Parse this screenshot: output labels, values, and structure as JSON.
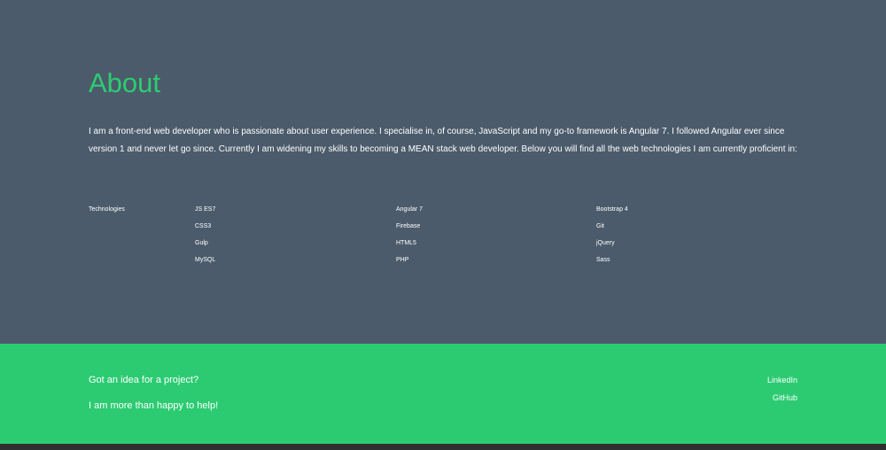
{
  "about": {
    "title": "About",
    "text": "I am a front-end web developer who is passionate about user experience. I specialise in, of course, JavaScript and my go-to framework is Angular 7. I followed Angular ever since version 1 and never let go since. Currently I am widening my skills to becoming a MEAN stack web developer. Below you will find all the web technologies I am currently proficient in:",
    "technologies_label": "Technologies",
    "technologies": [
      [
        "JS ES7",
        "Angular 7",
        "Bootstrap 4"
      ],
      [
        "CSS3",
        "Firebase",
        "Git"
      ],
      [
        "Gulp",
        "HTML5",
        "jQuery"
      ],
      [
        "MySQL",
        "PHP",
        "Sass"
      ]
    ]
  },
  "footer": {
    "line1": "Got an idea for a project?",
    "line2": "I am more than happy to help!",
    "links": [
      "LinkedIn",
      "GitHub"
    ]
  },
  "colors": {
    "accent": "#2ecc71",
    "about_bg": "#4b5b6b",
    "footer_bg": "#2ccb72",
    "bottom_bar": "#2f2f31"
  }
}
